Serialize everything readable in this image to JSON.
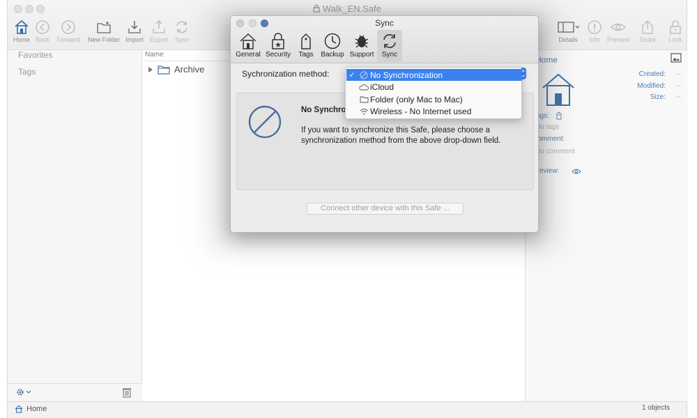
{
  "window": {
    "title": "Walk_EN.Safe"
  },
  "toolbar": {
    "home": "Home",
    "back": "Back",
    "forward": "Forward",
    "new_folder": "New Folder",
    "import": "Import",
    "export": "Export",
    "sync": "Sync",
    "details": "Details",
    "info": "Info",
    "preview": "Preview",
    "share": "Share",
    "lock": "Lock"
  },
  "sidebar": {
    "favorites": "Favorites",
    "tags": "Tags"
  },
  "list": {
    "column_name": "Name",
    "rows": [
      {
        "name": "Archive"
      }
    ]
  },
  "details": {
    "title": "Home",
    "created_label": "Created:",
    "created_value": "--",
    "modified_label": "Modified:",
    "modified_value": "--",
    "size_label": "Size:",
    "size_value": "--",
    "tags_label": "Tags:",
    "tags_placeholder": "No tags",
    "comment_label": "Comment:",
    "comment_placeholder": "No comment",
    "preview_label": "Preview:"
  },
  "statusbar": {
    "location": "Home",
    "count": "1 objects"
  },
  "sheet": {
    "title": "Sync",
    "tabs": [
      "General",
      "Security",
      "Tags",
      "Backup",
      "Support",
      "Sync"
    ],
    "active_tab": "Sync",
    "sync_method_label": "Sychronization method:",
    "info_title": "No Synchronization",
    "info_text": "If you want to synchronize this Safe, please choose a synchronization method from the above drop-down field.",
    "connect_button": "Connect other device with this Safe ..."
  },
  "dropdown": {
    "options": [
      {
        "label": "No Synchronization",
        "icon": "no-sync-icon",
        "selected": true
      },
      {
        "label": "iCloud",
        "icon": "cloud-icon",
        "selected": false
      },
      {
        "label": "Folder (only Mac to Mac)",
        "icon": "folder-icon",
        "selected": false
      },
      {
        "label": "Wireless - No Internet used",
        "icon": "wifi-icon",
        "selected": false
      }
    ],
    "checkmark": "✓"
  },
  "colors": {
    "accent": "#3b82f0",
    "link_blue": "#4d7bb0"
  }
}
